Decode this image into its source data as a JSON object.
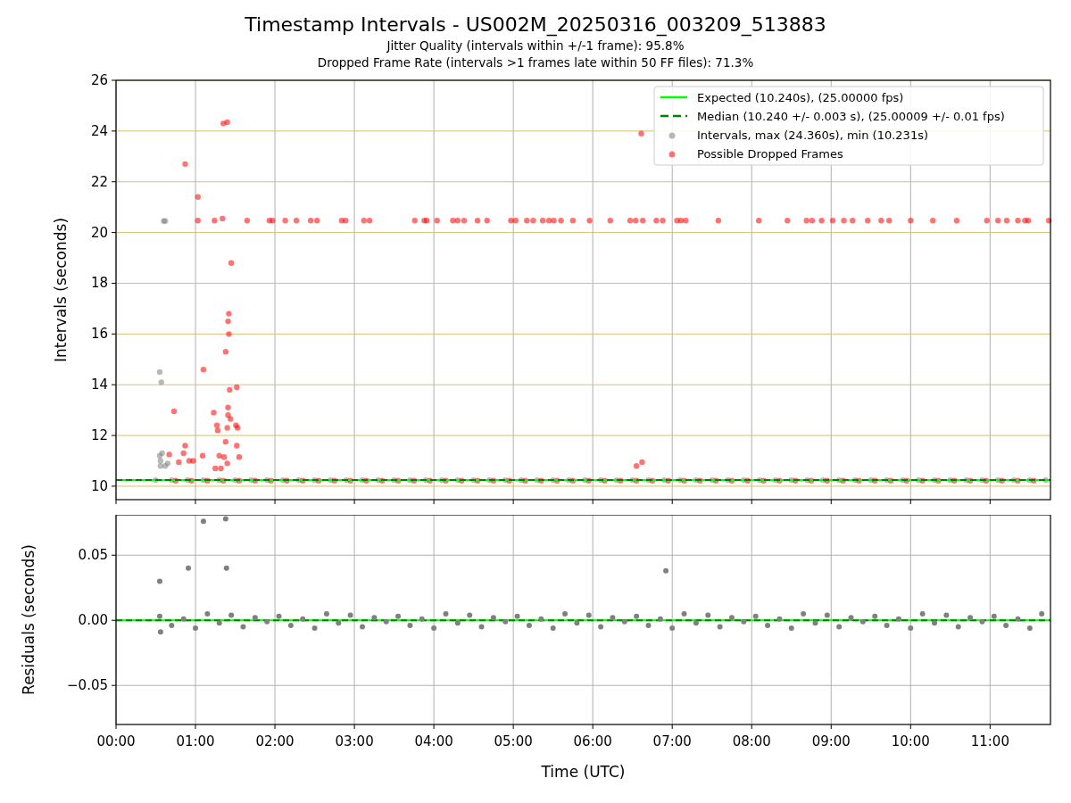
{
  "title": "Timestamp Intervals - US002M_20250316_003209_513883",
  "subtitles": [
    "Jitter Quality (intervals within +/-1 frame): 95.8%",
    "Dropped Frame Rate (intervals >1 frames late within 50 FF files): 71.3%"
  ],
  "charts": [
    {
      "chart_data": {
        "type": "scatter",
        "ylabel": "Intervals (seconds)",
        "xlim": [
          0,
          11.76
        ],
        "ylim": [
          9.47,
          26
        ],
        "grid": true,
        "yticks": [
          {
            "value": 10,
            "label": "10"
          },
          {
            "value": 12,
            "label": "12"
          },
          {
            "value": 14,
            "label": "14"
          },
          {
            "value": 16,
            "label": "16"
          },
          {
            "value": 18,
            "label": "18"
          },
          {
            "value": 20,
            "label": "20"
          },
          {
            "value": 22,
            "label": "22"
          },
          {
            "value": 24,
            "label": "24"
          },
          {
            "value": 26,
            "label": "26"
          }
        ],
        "legend": true,
        "ref_lines": [
          {
            "axis": "y",
            "value": 10.24,
            "color": "#00ff00",
            "label": "Expected (10.240s), (25.00000 fps)"
          },
          {
            "axis": "y",
            "value": 10.24,
            "color": "#008000",
            "label": "Median (10.240 +/- 0.003 s), (25.00009 +/- 0.01 fps)"
          }
        ],
        "series": [
          {
            "name": "Intervals, max (24.360s), min (10.231s)",
            "color": "#808080",
            "x": [
              0.55,
              0.57,
              0.58,
              0.55,
              0.56,
              0.6,
              0.62,
              0.65,
              0.62,
              0.56,
              0.5,
              0.7,
              0.9,
              1.1,
              1.3,
              1.5,
              1.7,
              1.9,
              2.1,
              2.3,
              2.5,
              2.7,
              2.9,
              3.1,
              3.3,
              3.5,
              3.7,
              3.9,
              4.1,
              4.3,
              4.5,
              4.7,
              4.9,
              5.1,
              5.3,
              5.5,
              5.7,
              5.9,
              6.1,
              6.3,
              6.5,
              6.7,
              6.9,
              7.1,
              7.3,
              7.5,
              7.7,
              7.9,
              8.1,
              8.3,
              8.5,
              8.7,
              8.9,
              9.1,
              9.3,
              9.5,
              9.7,
              9.9,
              10.1,
              10.3,
              10.5,
              10.7,
              10.9,
              11.1,
              11.3,
              11.5,
              11.7
            ],
            "values": [
              14.5,
              14.1,
              11.3,
              11.2,
              10.8,
              20.45,
              20.45,
              10.9,
              10.8,
              11.0,
              10.24,
              10.24,
              10.24,
              10.24,
              10.24,
              10.24,
              10.24,
              10.24,
              10.24,
              10.24,
              10.24,
              10.24,
              10.24,
              10.24,
              10.24,
              10.24,
              10.24,
              10.24,
              10.24,
              10.24,
              10.24,
              10.24,
              10.24,
              10.24,
              10.24,
              10.24,
              10.24,
              10.24,
              10.24,
              10.24,
              10.24,
              10.24,
              10.24,
              10.24,
              10.24,
              10.24,
              10.24,
              10.24,
              10.24,
              10.24,
              10.24,
              10.24,
              10.24,
              10.24,
              10.24,
              10.24,
              10.24,
              10.24,
              10.24,
              10.24,
              10.24,
              10.24,
              10.24,
              10.24,
              10.24,
              10.24,
              10.24
            ]
          },
          {
            "name": "Possible Dropped Frames",
            "color": "#ff0000",
            "x": [
              1.03,
              1.24,
              1.34,
              1.65,
              1.93,
              1.97,
              2.13,
              2.27,
              2.45,
              2.53,
              2.84,
              2.89,
              3.12,
              3.19,
              3.76,
              3.88,
              3.91,
              4.04,
              4.24,
              4.3,
              4.38,
              4.55,
              4.67,
              4.97,
              5.03,
              5.17,
              5.25,
              5.37,
              5.45,
              5.51,
              5.6,
              5.75,
              5.96,
              6.22,
              6.47,
              6.54,
              6.63,
              6.8,
              6.88,
              7.06,
              7.11,
              7.17,
              7.58,
              8.09,
              8.45,
              8.69,
              8.76,
              8.88,
              9.02,
              9.16,
              9.27,
              9.46,
              9.63,
              9.73,
              10.0,
              10.28,
              10.58,
              10.96,
              11.1,
              11.21,
              11.35,
              11.44,
              11.48,
              11.74,
              0.87,
              1.03,
              1.35,
              1.4,
              1.45,
              1.42,
              1.41,
              1.42,
              1.38,
              1.1,
              1.52,
              1.43,
              1.41,
              0.73,
              1.23,
              1.41,
              1.44,
              1.27,
              1.28,
              1.51,
              1.53,
              1.4,
              0.87,
              1.38,
              1.52,
              1.09,
              1.3,
              1.36,
              1.55,
              0.85,
              0.92,
              0.97,
              1.25,
              1.32,
              1.4,
              0.79,
              0.67,
              6.55,
              6.62,
              6.61,
              0.75,
              0.95,
              1.15,
              1.35,
              1.55,
              1.75,
              1.95,
              2.15,
              2.35,
              2.55,
              2.75,
              2.95,
              3.15,
              3.35,
              3.55,
              3.75,
              3.95,
              4.15,
              4.35,
              4.55,
              4.75,
              4.95,
              5.15,
              5.35,
              5.55,
              5.75,
              5.95,
              6.15,
              6.35,
              6.55,
              6.75,
              6.95,
              7.15,
              7.35,
              7.55,
              7.75,
              7.95,
              8.15,
              8.35,
              8.55,
              8.75,
              8.95,
              9.15,
              9.35,
              9.55,
              9.75,
              9.95,
              10.15,
              10.35,
              10.55,
              10.75,
              10.95,
              11.15,
              11.35,
              11.55
            ],
            "values": [
              20.47,
              20.47,
              20.55,
              20.47,
              20.47,
              20.47,
              20.47,
              20.47,
              20.47,
              20.47,
              20.47,
              20.47,
              20.47,
              20.47,
              20.47,
              20.47,
              20.47,
              20.47,
              20.47,
              20.47,
              20.47,
              20.47,
              20.47,
              20.47,
              20.47,
              20.47,
              20.47,
              20.47,
              20.47,
              20.47,
              20.47,
              20.47,
              20.47,
              20.47,
              20.47,
              20.47,
              20.47,
              20.47,
              20.47,
              20.47,
              20.47,
              20.47,
              20.47,
              20.47,
              20.47,
              20.47,
              20.47,
              20.47,
              20.47,
              20.47,
              20.47,
              20.47,
              20.47,
              20.47,
              20.47,
              20.47,
              20.47,
              20.47,
              20.47,
              20.47,
              20.47,
              20.47,
              20.47,
              20.47,
              22.7,
              21.4,
              24.3,
              24.35,
              18.8,
              16.8,
              16.5,
              16.0,
              15.3,
              14.6,
              13.9,
              13.8,
              13.1,
              12.95,
              12.9,
              12.8,
              12.65,
              12.4,
              12.2,
              12.4,
              12.3,
              12.3,
              11.6,
              11.75,
              11.6,
              11.2,
              11.2,
              11.15,
              11.15,
              11.3,
              11.0,
              11.0,
              10.7,
              10.7,
              10.9,
              10.95,
              11.25,
              10.8,
              10.95,
              23.9,
              10.22,
              10.22,
              10.22,
              10.22,
              10.22,
              10.22,
              10.22,
              10.22,
              10.22,
              10.22,
              10.22,
              10.22,
              10.22,
              10.22,
              10.22,
              10.22,
              10.22,
              10.22,
              10.22,
              10.22,
              10.22,
              10.22,
              10.22,
              10.22,
              10.22,
              10.22,
              10.22,
              10.22,
              10.22,
              10.22,
              10.22,
              10.22,
              10.22,
              10.22,
              10.22,
              10.22,
              10.22,
              10.22,
              10.22,
              10.22,
              10.22,
              10.22,
              10.22,
              10.22,
              10.22,
              10.22,
              10.22,
              10.22,
              10.22,
              10.22,
              10.22,
              10.22,
              10.22,
              10.22,
              10.22
            ]
          }
        ]
      }
    },
    {
      "chart_data": {
        "type": "scatter",
        "xlabel": "Time (UTC)",
        "ylabel": "Residuals (seconds)",
        "xlim": [
          0,
          11.76
        ],
        "ylim": [
          -0.08,
          0.081
        ],
        "grid": true,
        "ref_lines": [
          {
            "axis": "y",
            "value": 0,
            "color": "#00ff00"
          },
          {
            "axis": "y",
            "value": 0,
            "color": "#008000"
          }
        ],
        "xticks": [
          {
            "value": 0,
            "label": "00:00"
          },
          {
            "value": 1,
            "label": "01:00"
          },
          {
            "value": 2,
            "label": "02:00"
          },
          {
            "value": 3,
            "label": "03:00"
          },
          {
            "value": 4,
            "label": "04:00"
          },
          {
            "value": 5,
            "label": "05:00"
          },
          {
            "value": 6,
            "label": "06:00"
          },
          {
            "value": 7,
            "label": "07:00"
          },
          {
            "value": 8,
            "label": "08:00"
          },
          {
            "value": 9,
            "label": "09:00"
          },
          {
            "value": 10,
            "label": "10:00"
          },
          {
            "value": 11,
            "label": "11:00"
          }
        ],
        "yticks": [
          {
            "value": -0.05,
            "label": "−0.05"
          },
          {
            "value": 0,
            "label": "0.00"
          },
          {
            "value": 0.05,
            "label": "0.05"
          }
        ],
        "series": [
          {
            "color": "#808080",
            "x": [
              0.55,
              0.7,
              0.85,
              1.0,
              1.15,
              1.3,
              1.45,
              1.6,
              1.75,
              1.9,
              2.05,
              2.2,
              2.35,
              2.5,
              2.65,
              2.8,
              2.95,
              3.1,
              3.25,
              3.4,
              3.55,
              3.7,
              3.85,
              4.0,
              4.15,
              4.3,
              4.45,
              4.6,
              4.75,
              4.9,
              5.05,
              5.2,
              5.35,
              5.5,
              5.65,
              5.8,
              5.95,
              6.1,
              6.25,
              6.4,
              6.55,
              6.7,
              6.85,
              7.0,
              7.15,
              7.3,
              7.45,
              7.6,
              7.75,
              7.9,
              8.05,
              8.2,
              8.35,
              8.5,
              8.65,
              8.8,
              8.95,
              9.1,
              9.25,
              9.4,
              9.55,
              9.7,
              9.85,
              10.0,
              10.15,
              10.3,
              10.45,
              10.6,
              10.75,
              10.9,
              11.05,
              11.2,
              11.35,
              11.5,
              11.65,
              0.55,
              0.91,
              1.1,
              1.38,
              1.39,
              6.92,
              0.56
            ],
            "values": [
              0.003,
              -0.004,
              0.001,
              -0.006,
              0.005,
              -0.002,
              0.004,
              -0.005,
              0.002,
              -0.001,
              0.003,
              -0.004,
              0.001,
              -0.006,
              0.005,
              -0.002,
              0.004,
              -0.005,
              0.002,
              -0.001,
              0.003,
              -0.004,
              0.001,
              -0.006,
              0.005,
              -0.002,
              0.004,
              -0.005,
              0.002,
              -0.001,
              0.003,
              -0.004,
              0.001,
              -0.006,
              0.005,
              -0.002,
              0.004,
              -0.005,
              0.002,
              -0.001,
              0.003,
              -0.004,
              0.001,
              -0.006,
              0.005,
              -0.002,
              0.004,
              -0.005,
              0.002,
              -0.001,
              0.003,
              -0.004,
              0.001,
              -0.006,
              0.005,
              -0.002,
              0.004,
              -0.005,
              0.002,
              -0.001,
              0.003,
              -0.004,
              0.001,
              -0.006,
              0.005,
              -0.002,
              0.004,
              -0.005,
              0.002,
              -0.001,
              0.003,
              -0.004,
              0.001,
              -0.006,
              0.005,
              0.03,
              0.04,
              0.076,
              0.078,
              0.04,
              0.038,
              -0.009
            ]
          }
        ]
      }
    }
  ]
}
